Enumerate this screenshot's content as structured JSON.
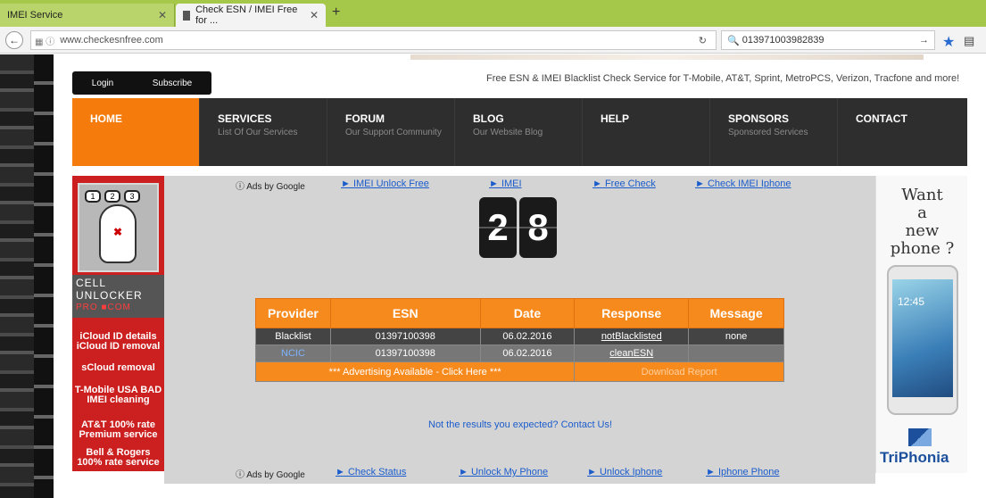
{
  "browser": {
    "tabs": [
      {
        "label": "IMEI Service"
      },
      {
        "label": "Check ESN / IMEI Free for ..."
      }
    ],
    "url": "www.checkesnfree.com",
    "search_value": "013971003982839"
  },
  "header": {
    "login": "Login",
    "subscribe": "Subscribe",
    "tagline": "Free ESN & IMEI Blacklist Check Service for T-Mobile, AT&T, Sprint, MetroPCS, Verizon, Tracfone and more!"
  },
  "nav": [
    {
      "title": "HOME",
      "sub": ""
    },
    {
      "title": "SERVICES",
      "sub": "List Of Our Services"
    },
    {
      "title": "FORUM",
      "sub": "Our Support Community"
    },
    {
      "title": "BLOG",
      "sub": "Our Website Blog"
    },
    {
      "title": "HELP",
      "sub": ""
    },
    {
      "title": "SPONSORS",
      "sub": "Sponsored Services"
    },
    {
      "title": "CONTACT",
      "sub": ""
    }
  ],
  "left_ad": {
    "brand_line1": "CELL",
    "brand_line2": "UNLOCKER",
    "brand_line3": "PRO ■COM",
    "lines": [
      "iCloud ID details iCloud ID removal",
      "sCloud removal",
      "T-Mobile USA BAD IMEI cleaning",
      "AT&T 100% rate Premium service",
      "Bell & Rogers 100% rate service"
    ]
  },
  "ads_top": {
    "adsby": "ⓘ Ads by Google",
    "links": [
      "► IMEI Unlock Free",
      "► IMEI",
      "► Free Check",
      "► Check IMEI Iphone"
    ]
  },
  "ads_bottom": {
    "adsby": "ⓘ Ads by Google",
    "links": [
      "► Check Status",
      "► Unlock My Phone",
      "► Unlock Iphone",
      "► Iphone Phone"
    ]
  },
  "counter": {
    "d1": "2",
    "d2": "8"
  },
  "results": {
    "headers": [
      "Provider",
      "ESN",
      "Date",
      "Response",
      "Message"
    ],
    "rows": [
      {
        "provider": "Blacklist",
        "esn": "01397100398",
        "date": "06.02.2016",
        "response": "notBlacklisted",
        "message": "none"
      },
      {
        "provider": "NCIC",
        "esn": "01397100398",
        "date": "06.02.2016",
        "response": "cleanESN",
        "message": ""
      }
    ],
    "advert": "*** Advertising Available - Click Here ***",
    "download": "Download Report"
  },
  "not_expected": "Not the results you expected?   Contact Us!",
  "right_ad": {
    "want": [
      "Want",
      "a",
      "new",
      "phone ?"
    ],
    "time": "12:45",
    "brand": "TriPhonia"
  },
  "colors": {
    "accent": "#f78a1d",
    "nav_bg": "#2e2e2e",
    "chrome_green": "#a6c84a"
  }
}
